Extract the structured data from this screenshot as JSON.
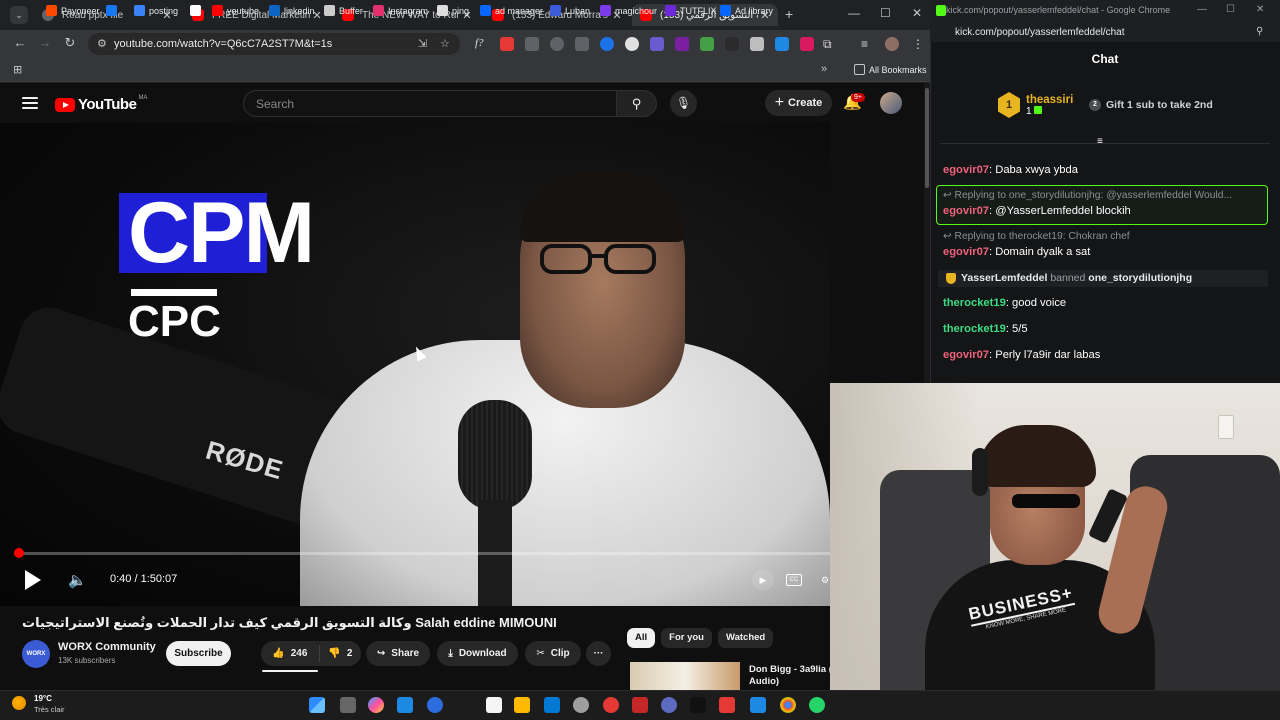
{
  "browser": {
    "tabs": [
      {
        "title": "Read pptx file",
        "color": "#5f6368",
        "active": false
      },
      {
        "title": "FREE Digital Marketing Cou",
        "color": "#ff0000",
        "active": false
      },
      {
        "title": "The NEW WAY to Run Meta",
        "color": "#ff0000",
        "active": false
      },
      {
        "title": "(153) Edward Morra's Them",
        "color": "#ff0000",
        "active": false
      },
      {
        "title": "(153) وكالة التسويق الرقمي",
        "color": "#ff0000",
        "active": true
      }
    ],
    "new_tab": "+",
    "url": "youtube.com/watch?v=Q6cC7A2ST7M&t=1s",
    "bookmarks": [
      {
        "label": "Payoneer",
        "color": "#ff4800"
      },
      {
        "label": "",
        "color": "#1877f2"
      },
      {
        "label": "posting",
        "color": "#3b82f6"
      },
      {
        "label": "",
        "color": "#ffffff"
      },
      {
        "label": "youtube",
        "color": "#ff0000"
      },
      {
        "label": "linkedin",
        "color": "#0a66c2"
      },
      {
        "label": "Buffer",
        "color": "#cccccc"
      },
      {
        "label": "Instagram",
        "color": "#e1306c"
      },
      {
        "label": "ping",
        "color": "#dddddd"
      },
      {
        "label": "ad manager",
        "color": "#0866ff"
      },
      {
        "label": "Luban",
        "color": "#3b5bdb"
      },
      {
        "label": "magichour",
        "color": "#7c3aed"
      },
      {
        "label": "TUTFLIX",
        "color": "#6d28d9"
      },
      {
        "label": "Ad library",
        "color": "#0866ff"
      }
    ],
    "all_bookmarks": "All Bookmarks"
  },
  "youtube": {
    "logo": "YouTube",
    "logo_region": "MA",
    "search_placeholder": "Search",
    "create_label": "Create",
    "notif_count": "9+",
    "video_overlay": {
      "big": "CPM",
      "small": "CPC",
      "mic_brand": "RØDE"
    },
    "progress": 0.006,
    "time": "0:40 / 1:50:07",
    "title": "وكالة التسويق الرقمي كيف تدار الحملات وتُصنع الاستراتيجيات Salah eddine MIMOUNI",
    "channel": {
      "name": "WORX Community",
      "subs": "13K subscribers",
      "avatar_text": "WORX"
    },
    "subscribe": "Subscribe",
    "likes": "246",
    "dislikes": "2",
    "share": "Share",
    "download": "Download",
    "clip": "Clip",
    "more": "···",
    "chips": [
      "All",
      "For you",
      "Watched"
    ],
    "rec_title": "Don Bigg - 3a9lia (",
    "rec_title2": "Audio)"
  },
  "kick": {
    "window_title": "kick.com/popout/yasserlemfeddel/chat - Google Chrome",
    "url": "kick.com/popout/yasserlemfeddel/chat",
    "chat_title": "Chat",
    "top_gifter": {
      "rank": "1",
      "name": "theassiri",
      "count": "1"
    },
    "gift_cta": "Gift 1 sub to take 2nd",
    "messages": [
      {
        "user": "egovir07",
        "text": "Daba xwya ybda",
        "color": "#f0637c"
      },
      {
        "reply_to": "Replying to one_storydilutionjhg: @yasserlemfeddel Would...",
        "user": "egovir07",
        "text": "@YasserLemfeddel blockih",
        "color": "#f0637c"
      },
      {
        "reply_to": "Replying to therocket19: Chokran chef",
        "user": "egovir07",
        "text": "Domain dyalk a sat",
        "color": "#f0637c"
      },
      {
        "system": true,
        "user": "YasserLemfeddel",
        "action": "banned",
        "target": "one_storydilutionjhg"
      },
      {
        "user": "therocket19",
        "text": "good voice",
        "color": "#3ddc84"
      },
      {
        "user": "therocket19",
        "text": "5/5",
        "color": "#3ddc84"
      },
      {
        "user": "egovir07",
        "text": "Perly l7a9ir dar labas",
        "color": "#f0637c"
      }
    ]
  },
  "webcam": {
    "shirt_text": "BUSINESS+",
    "shirt_sub": "KNOW MORE, SHARE MORE"
  },
  "taskbar": {
    "temp": "19°C",
    "weather": "Très clair"
  }
}
